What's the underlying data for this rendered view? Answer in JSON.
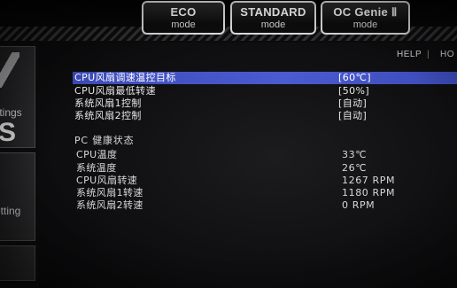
{
  "modes": {
    "eco": {
      "line1": "ECO",
      "line2": "mode"
    },
    "standard": {
      "line1": "STANDARD",
      "line2": "mode"
    },
    "ocgenie": {
      "line1": "OC Genie Ⅱ",
      "line2": "mode"
    }
  },
  "header": {
    "help": "HELP",
    "separator": "|",
    "hotkey": "HO"
  },
  "sidebar": {
    "settings_text": "ttings",
    "settings_big": "S",
    "oc_text": "etting"
  },
  "fan_settings": [
    {
      "label": "CPU风扇调速温控目标",
      "value": "[60℃]",
      "selected": true
    },
    {
      "label": "CPU风扇最低转速",
      "value": "[50%]",
      "selected": false
    },
    {
      "label": "系统风扇1控制",
      "value": "[自动]",
      "selected": false
    },
    {
      "label": "系统风扇2控制",
      "value": "[自动]",
      "selected": false
    }
  ],
  "health": {
    "title": "PC 健康状态",
    "items": [
      {
        "label": "CPU温度",
        "value": "33℃"
      },
      {
        "label": "系统温度",
        "value": "26℃"
      },
      {
        "label": "CPU风扇转速",
        "value": "1267 RPM"
      },
      {
        "label": "系统风扇1转速",
        "value": "1180 RPM"
      },
      {
        "label": "系统风扇2转速",
        "value": "0 RPM"
      }
    ]
  },
  "colors": {
    "selection": "#4453c4",
    "text": "#e6e6e6",
    "background": "#121214"
  }
}
